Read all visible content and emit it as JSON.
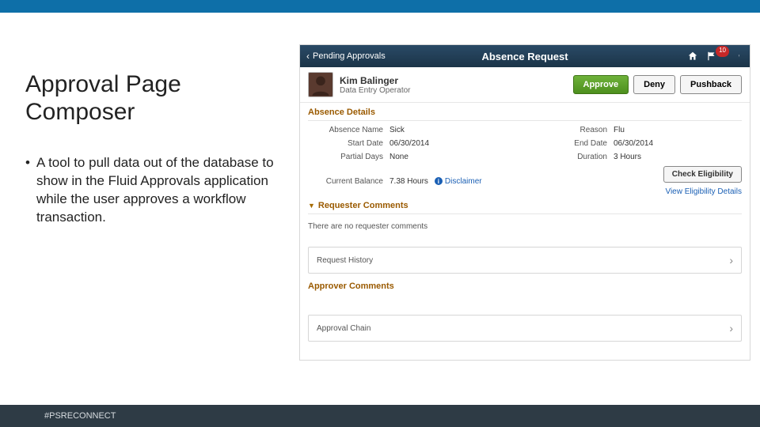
{
  "slide": {
    "title_line1": "Approval Page",
    "title_line2": "Composer",
    "bullet": "A tool to pull data out of the database to show in the Fluid Approvals application while the user approves a workflow transaction.",
    "hashtag": "#PSRECONNECT"
  },
  "app": {
    "back_label": "Pending Approvals",
    "title": "Absence Request",
    "notification_count": "10",
    "person": {
      "name": "Kim Balinger",
      "role": "Data Entry Operator"
    },
    "actions": {
      "approve": "Approve",
      "deny": "Deny",
      "pushback": "Pushback"
    },
    "details": {
      "section_title": "Absence Details",
      "absence_name_lbl": "Absence Name",
      "absence_name_val": "Sick",
      "reason_lbl": "Reason",
      "reason_val": "Flu",
      "start_lbl": "Start Date",
      "start_val": "06/30/2014",
      "end_lbl": "End Date",
      "end_val": "06/30/2014",
      "partial_lbl": "Partial Days",
      "partial_val": "None",
      "duration_lbl": "Duration",
      "duration_val": "3 Hours",
      "balance_lbl": "Current Balance",
      "balance_val": "7.38 Hours",
      "disclaimer": "Disclaimer",
      "check_eligibility": "Check Eligibility",
      "view_details": "View Eligibility Details"
    },
    "requester": {
      "section_title": "Requester Comments",
      "empty": "There are no requester comments"
    },
    "rows": {
      "request_history": "Request History",
      "approver_comments": "Approver Comments",
      "approval_chain": "Approval Chain"
    }
  }
}
